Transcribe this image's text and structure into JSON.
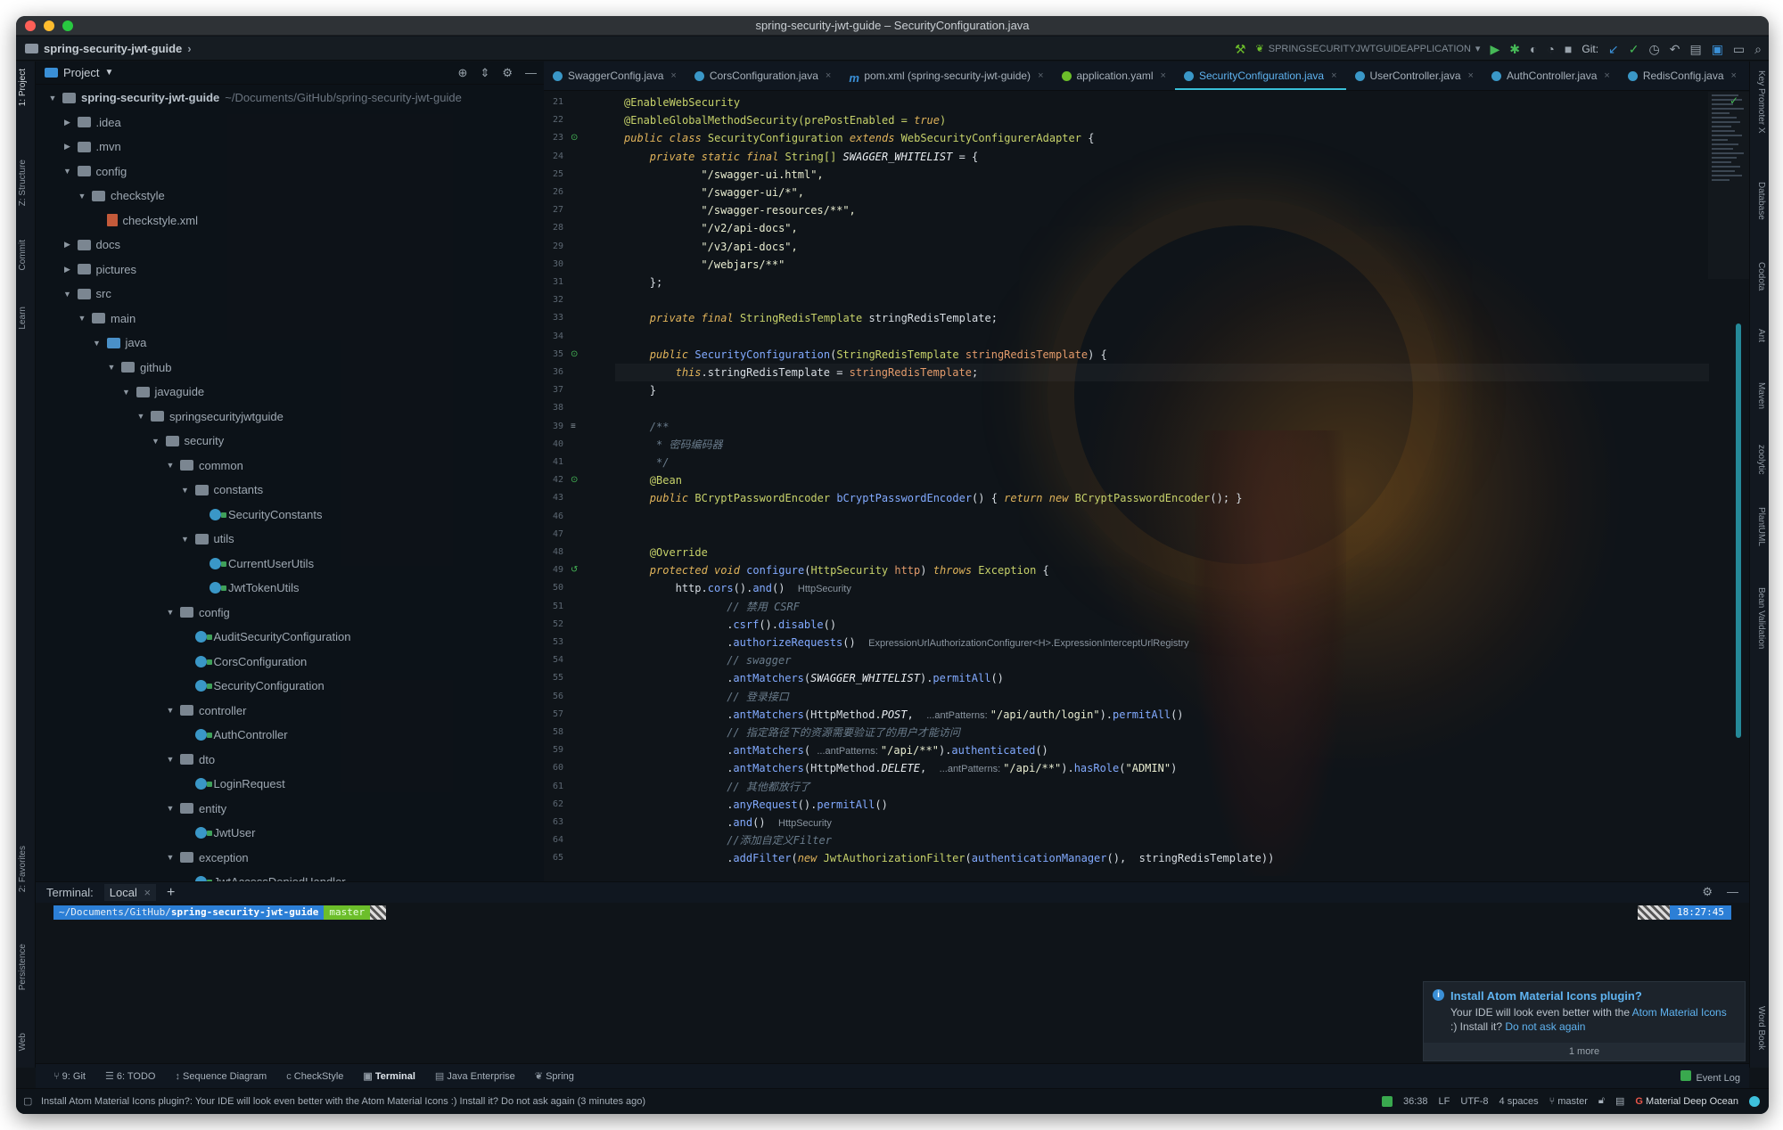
{
  "window_title": "spring-security-jwt-guide – SecurityConfiguration.java",
  "navbar": {
    "crumb": "spring-security-jwt-guide",
    "run_config": "SPRINGSECURITYJWTGUIDEAPPLICATION",
    "git_label": "Git:"
  },
  "left_strip": [
    "1: Project",
    "Z: Structure",
    "Commit",
    "Learn",
    "2: Favorites",
    "Persistence",
    "Web"
  ],
  "right_strip": [
    "Key Promoter X",
    "Database",
    "Codota",
    "Ant",
    "Maven",
    "zoolytic",
    "PlantUML",
    "Bean Validation",
    "Word Book"
  ],
  "project": {
    "header": "Project",
    "tree": [
      {
        "depth": 0,
        "arrow": "▼",
        "kind": "folder",
        "label": "spring-security-jwt-guide",
        "dim": "~/Documents/GitHub/spring-security-jwt-guide",
        "bold": true
      },
      {
        "depth": 1,
        "arrow": "▶",
        "kind": "folder",
        "label": ".idea"
      },
      {
        "depth": 1,
        "arrow": "▶",
        "kind": "folder",
        "label": ".mvn"
      },
      {
        "depth": 1,
        "arrow": "▼",
        "kind": "folder",
        "label": "config"
      },
      {
        "depth": 2,
        "arrow": "▼",
        "kind": "folder",
        "label": "checkstyle"
      },
      {
        "depth": 3,
        "arrow": "",
        "kind": "xml",
        "label": "checkstyle.xml"
      },
      {
        "depth": 1,
        "arrow": "▶",
        "kind": "folder",
        "label": "docs"
      },
      {
        "depth": 1,
        "arrow": "▶",
        "kind": "folder",
        "label": "pictures"
      },
      {
        "depth": 1,
        "arrow": "▼",
        "kind": "folder",
        "label": "src"
      },
      {
        "depth": 2,
        "arrow": "▼",
        "kind": "folder",
        "label": "main"
      },
      {
        "depth": 3,
        "arrow": "▼",
        "kind": "folderblue",
        "label": "java"
      },
      {
        "depth": 4,
        "arrow": "▼",
        "kind": "folder",
        "label": "github"
      },
      {
        "depth": 5,
        "arrow": "▼",
        "kind": "folder",
        "label": "javaguide"
      },
      {
        "depth": 6,
        "arrow": "▼",
        "kind": "folder",
        "label": "springsecurityjwtguide"
      },
      {
        "depth": 7,
        "arrow": "▼",
        "kind": "folder",
        "label": "security"
      },
      {
        "depth": 8,
        "arrow": "▼",
        "kind": "folder",
        "label": "common"
      },
      {
        "depth": 9,
        "arrow": "▼",
        "kind": "folder",
        "label": "constants"
      },
      {
        "depth": 10,
        "arrow": "",
        "kind": "class",
        "label": "SecurityConstants"
      },
      {
        "depth": 9,
        "arrow": "▼",
        "kind": "folder",
        "label": "utils"
      },
      {
        "depth": 10,
        "arrow": "",
        "kind": "class",
        "label": "CurrentUserUtils"
      },
      {
        "depth": 10,
        "arrow": "",
        "kind": "class",
        "label": "JwtTokenUtils"
      },
      {
        "depth": 8,
        "arrow": "▼",
        "kind": "folder",
        "label": "config"
      },
      {
        "depth": 9,
        "arrow": "",
        "kind": "class",
        "label": "AuditSecurityConfiguration"
      },
      {
        "depth": 9,
        "arrow": "",
        "kind": "class",
        "label": "CorsConfiguration"
      },
      {
        "depth": 9,
        "arrow": "",
        "kind": "class",
        "label": "SecurityConfiguration"
      },
      {
        "depth": 8,
        "arrow": "▼",
        "kind": "folder",
        "label": "controller"
      },
      {
        "depth": 9,
        "arrow": "",
        "kind": "class",
        "label": "AuthController"
      },
      {
        "depth": 8,
        "arrow": "▼",
        "kind": "folder",
        "label": "dto"
      },
      {
        "depth": 9,
        "arrow": "",
        "kind": "class",
        "label": "LoginRequest"
      },
      {
        "depth": 8,
        "arrow": "▼",
        "kind": "folder",
        "label": "entity"
      },
      {
        "depth": 9,
        "arrow": "",
        "kind": "class",
        "label": "JwtUser"
      },
      {
        "depth": 8,
        "arrow": "▼",
        "kind": "folder",
        "label": "exception"
      },
      {
        "depth": 9,
        "arrow": "",
        "kind": "class",
        "label": "JwtAccessDeniedHandler"
      }
    ]
  },
  "tabs": [
    {
      "label": "SwaggerConfig.java",
      "active": false
    },
    {
      "label": "CorsConfiguration.java",
      "active": false
    },
    {
      "label": "pom.xml (spring-security-jwt-guide)",
      "active": false
    },
    {
      "label": "application.yaml",
      "active": false
    },
    {
      "label": "SecurityConfiguration.java",
      "active": true
    },
    {
      "label": "UserController.java",
      "active": false
    },
    {
      "label": "AuthController.java",
      "active": false
    },
    {
      "label": "RedisConfig.java",
      "active": false
    }
  ],
  "code": [
    {
      "n": "21",
      "indent": 0,
      "t": [
        [
          "ann",
          "@EnableWebSecurity"
        ]
      ]
    },
    {
      "n": "22",
      "indent": 0,
      "t": [
        [
          "ann",
          "@EnableGlobalMethodSecurity(prePostEnabled = "
        ],
        [
          "kw",
          "true"
        ],
        [
          "ann",
          ")"
        ]
      ]
    },
    {
      "n": "23",
      "indent": 0,
      "t": [
        [
          "kw",
          "public class "
        ],
        [
          "typ",
          "SecurityConfiguration "
        ],
        [
          "kw",
          "extends "
        ],
        [
          "typ",
          "WebSecurityConfigurerAdapter "
        ],
        [
          "fld",
          "{"
        ]
      ]
    },
    {
      "n": "24",
      "indent": 4,
      "t": [
        [
          "kw",
          "private static final "
        ],
        [
          "typ",
          "String[] "
        ],
        [
          "cns",
          "SWAGGER_WHITELIST"
        ],
        [
          "fld",
          " = {"
        ]
      ]
    },
    {
      "n": "25",
      "indent": 12,
      "t": [
        [
          "str",
          "\"/swagger-ui.html\","
        ]
      ]
    },
    {
      "n": "26",
      "indent": 12,
      "t": [
        [
          "str",
          "\"/swagger-ui/*\","
        ]
      ]
    },
    {
      "n": "27",
      "indent": 12,
      "t": [
        [
          "str",
          "\"/swagger-resources/**\","
        ]
      ]
    },
    {
      "n": "28",
      "indent": 12,
      "t": [
        [
          "str",
          "\"/v2/api-docs\","
        ]
      ]
    },
    {
      "n": "29",
      "indent": 12,
      "t": [
        [
          "str",
          "\"/v3/api-docs\","
        ]
      ]
    },
    {
      "n": "30",
      "indent": 12,
      "t": [
        [
          "str",
          "\"/webjars/**\""
        ]
      ]
    },
    {
      "n": "31",
      "indent": 4,
      "t": [
        [
          "fld",
          "};"
        ]
      ]
    },
    {
      "n": "32",
      "indent": 0,
      "t": []
    },
    {
      "n": "33",
      "indent": 4,
      "t": [
        [
          "kw",
          "private final "
        ],
        [
          "typ",
          "StringRedisTemplate "
        ],
        [
          "fld",
          "stringRedisTemplate;"
        ]
      ]
    },
    {
      "n": "34",
      "indent": 0,
      "t": []
    },
    {
      "n": "35",
      "indent": 4,
      "t": [
        [
          "kw",
          "public "
        ],
        [
          "fn",
          "SecurityConfiguration"
        ],
        [
          "fld",
          "("
        ],
        [
          "typ",
          "StringRedisTemplate "
        ],
        [
          "prm",
          "stringRedisTemplate"
        ],
        [
          "fld",
          ") {"
        ]
      ]
    },
    {
      "n": "36",
      "indent": 8,
      "hl": true,
      "t": [
        [
          "thiskw",
          "this"
        ],
        [
          "fld",
          ".stringRedisTemplate = "
        ],
        [
          "prm",
          "stringRedisTemplate"
        ],
        [
          "fld",
          ";"
        ]
      ]
    },
    {
      "n": "37",
      "indent": 4,
      "t": [
        [
          "fld",
          "}"
        ]
      ]
    },
    {
      "n": "38",
      "indent": 0,
      "t": []
    },
    {
      "n": "39",
      "indent": 4,
      "t": [
        [
          "cm",
          "/**"
        ]
      ]
    },
    {
      "n": "40",
      "indent": 4,
      "t": [
        [
          "cm",
          " * 密码编码器"
        ]
      ]
    },
    {
      "n": "41",
      "indent": 4,
      "t": [
        [
          "cm",
          " */"
        ]
      ]
    },
    {
      "n": "42",
      "indent": 4,
      "t": [
        [
          "ann",
          "@Bean"
        ]
      ]
    },
    {
      "n": "43",
      "indent": 4,
      "t": [
        [
          "kw",
          "public "
        ],
        [
          "typ",
          "BCryptPasswordEncoder "
        ],
        [
          "fn",
          "bCryptPasswordEncoder"
        ],
        [
          "fld",
          "() { "
        ],
        [
          "kw",
          "return new "
        ],
        [
          "typ",
          "BCryptPasswordEncoder"
        ],
        [
          "fld",
          "(); }"
        ]
      ]
    },
    {
      "n": "46",
      "indent": 0,
      "t": []
    },
    {
      "n": "47",
      "indent": 0,
      "t": []
    },
    {
      "n": "48",
      "indent": 4,
      "t": [
        [
          "ann",
          "@Override"
        ]
      ]
    },
    {
      "n": "49",
      "indent": 4,
      "t": [
        [
          "kw",
          "protected void "
        ],
        [
          "fn",
          "configure"
        ],
        [
          "fld",
          "("
        ],
        [
          "typ",
          "HttpSecurity "
        ],
        [
          "prm",
          "http"
        ],
        [
          "fld",
          ") "
        ],
        [
          "kw",
          "throws "
        ],
        [
          "typ",
          "Exception "
        ],
        [
          "fld",
          "{"
        ]
      ]
    },
    {
      "n": "50",
      "indent": 8,
      "t": [
        [
          "fld",
          "http."
        ],
        [
          "fn",
          "cors"
        ],
        [
          "fld",
          "()."
        ],
        [
          "fn",
          "and"
        ],
        [
          "fld",
          "()  "
        ],
        [
          "hint",
          "HttpSecurity"
        ]
      ]
    },
    {
      "n": "51",
      "indent": 16,
      "t": [
        [
          "cm",
          "// 禁用 CSRF"
        ]
      ]
    },
    {
      "n": "52",
      "indent": 16,
      "t": [
        [
          "fld",
          "."
        ],
        [
          "fn",
          "csrf"
        ],
        [
          "fld",
          "()."
        ],
        [
          "fn",
          "disable"
        ],
        [
          "fld",
          "()"
        ]
      ]
    },
    {
      "n": "53",
      "indent": 16,
      "t": [
        [
          "fld",
          "."
        ],
        [
          "fn",
          "authorizeRequests"
        ],
        [
          "fld",
          "()  "
        ],
        [
          "hint",
          "ExpressionUrlAuthorizationConfigurer<H>.ExpressionInterceptUrlRegistry"
        ]
      ]
    },
    {
      "n": "54",
      "indent": 16,
      "t": [
        [
          "cm",
          "// swagger"
        ]
      ]
    },
    {
      "n": "55",
      "indent": 16,
      "t": [
        [
          "fld",
          "."
        ],
        [
          "fn",
          "antMatchers"
        ],
        [
          "fld",
          "("
        ],
        [
          "cns",
          "SWAGGER_WHITELIST"
        ],
        [
          "fld",
          ")."
        ],
        [
          "fn",
          "permitAll"
        ],
        [
          "fld",
          "()"
        ]
      ]
    },
    {
      "n": "56",
      "indent": 16,
      "t": [
        [
          "cm",
          "// 登录接口"
        ]
      ]
    },
    {
      "n": "57",
      "indent": 16,
      "t": [
        [
          "fld",
          "."
        ],
        [
          "fn",
          "antMatchers"
        ],
        [
          "fld",
          "(HttpMethod."
        ],
        [
          "cns",
          "POST"
        ],
        [
          "fld",
          ",  "
        ],
        [
          "hint",
          "...antPatterns: "
        ],
        [
          "str",
          "\"/api/auth/login\""
        ],
        [
          "fld",
          ")."
        ],
        [
          "fn",
          "permitAll"
        ],
        [
          "fld",
          "()"
        ]
      ]
    },
    {
      "n": "58",
      "indent": 16,
      "t": [
        [
          "cm",
          "// 指定路径下的资源需要验证了的用户才能访问"
        ]
      ]
    },
    {
      "n": "59",
      "indent": 16,
      "t": [
        [
          "fld",
          "."
        ],
        [
          "fn",
          "antMatchers"
        ],
        [
          "fld",
          "( "
        ],
        [
          "hint",
          "...antPatterns: "
        ],
        [
          "str",
          "\"/api/**\""
        ],
        [
          "fld",
          ")."
        ],
        [
          "fn",
          "authenticated"
        ],
        [
          "fld",
          "()"
        ]
      ]
    },
    {
      "n": "60",
      "indent": 16,
      "t": [
        [
          "fld",
          "."
        ],
        [
          "fn",
          "antMatchers"
        ],
        [
          "fld",
          "(HttpMethod."
        ],
        [
          "cns",
          "DELETE"
        ],
        [
          "fld",
          ",  "
        ],
        [
          "hint",
          "...antPatterns: "
        ],
        [
          "str",
          "\"/api/**\""
        ],
        [
          "fld",
          ")."
        ],
        [
          "fn",
          "hasRole"
        ],
        [
          "fld",
          "("
        ],
        [
          "str",
          "\"ADMIN\""
        ],
        [
          "fld",
          ")"
        ]
      ]
    },
    {
      "n": "61",
      "indent": 16,
      "t": [
        [
          "cm",
          "// 其他都放行了"
        ]
      ]
    },
    {
      "n": "62",
      "indent": 16,
      "t": [
        [
          "fld",
          "."
        ],
        [
          "fn",
          "anyRequest"
        ],
        [
          "fld",
          "()."
        ],
        [
          "fn",
          "permitAll"
        ],
        [
          "fld",
          "()"
        ]
      ]
    },
    {
      "n": "63",
      "indent": 16,
      "t": [
        [
          "fld",
          "."
        ],
        [
          "fn",
          "and"
        ],
        [
          "fld",
          "()  "
        ],
        [
          "hint",
          "HttpSecurity"
        ]
      ]
    },
    {
      "n": "64",
      "indent": 16,
      "t": [
        [
          "cm",
          "//添加自定义Filter"
        ]
      ]
    },
    {
      "n": "65",
      "indent": 16,
      "t": [
        [
          "fld",
          "."
        ],
        [
          "fn",
          "addFilter"
        ],
        [
          "fld",
          "("
        ],
        [
          "kw",
          "new "
        ],
        [
          "typ",
          "JwtAuthorizationFilter"
        ],
        [
          "fld",
          "("
        ],
        [
          "fn",
          "authenticationManager"
        ],
        [
          "fld",
          "(),  stringRedisTemplate))"
        ]
      ]
    }
  ],
  "terminal": {
    "label": "Terminal:",
    "tab": "Local",
    "path_prefix": "~/Documents/GitHub/",
    "path_repo": "spring-security-jwt-guide",
    "branch": "master",
    "time": "18:27:45"
  },
  "notification": {
    "title": "Install Atom Material Icons plugin?",
    "body1": "Your IDE will look even better with the ",
    "link1": "Atom Material Icons",
    "body2": " :) Install it? ",
    "link2": "Do not ask again",
    "more": "1 more"
  },
  "toolwindows": [
    "9: Git",
    "6: TODO",
    "Sequence Diagram",
    "CheckStyle",
    "Terminal",
    "Java Enterprise",
    "Spring"
  ],
  "toolwindows_selected": "Terminal",
  "event_log": "Event Log",
  "status": {
    "message": "Install Atom Material Icons plugin?: Your IDE will look even better with the Atom Material Icons :) Install it? Do not ask again (3 minutes ago)",
    "position": "36:38",
    "line_sep": "LF",
    "encoding": "UTF-8",
    "indent": "4 spaces",
    "branch": "master",
    "theme": "Material Deep Ocean"
  },
  "colors": {
    "accent": "#39c0d8",
    "link": "#5fb3f0",
    "background": "#0f1419"
  }
}
